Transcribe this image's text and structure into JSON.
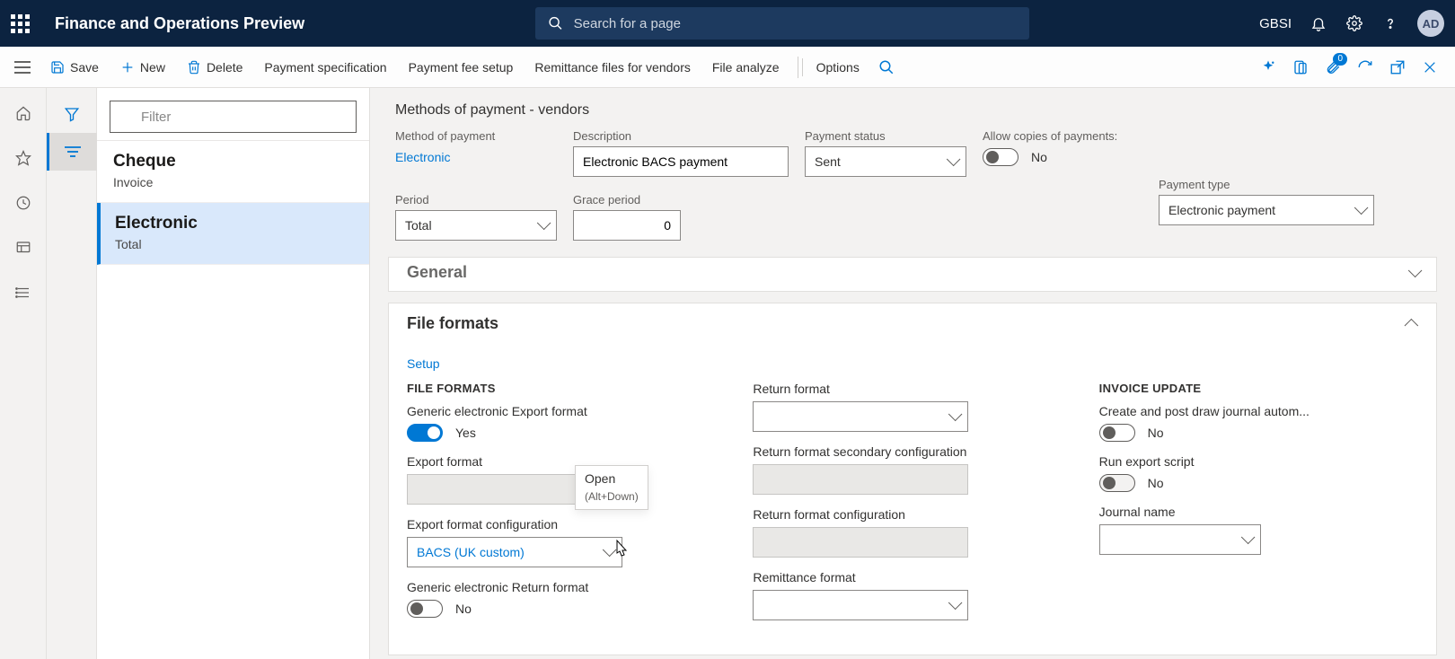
{
  "header": {
    "app_title": "Finance and Operations Preview",
    "search_placeholder": "Search for a page",
    "company": "GBSI",
    "avatar": "AD"
  },
  "actions": {
    "save": "Save",
    "new": "New",
    "delete": "Delete",
    "payment_spec": "Payment specification",
    "payment_fee": "Payment fee setup",
    "remittance": "Remittance files for vendors",
    "file_analyze": "File analyze",
    "options": "Options",
    "notif_badge": "0"
  },
  "filter": {
    "placeholder": "Filter"
  },
  "list": [
    {
      "title": "Cheque",
      "sub": "Invoice"
    },
    {
      "title": "Electronic",
      "sub": "Total"
    }
  ],
  "page": {
    "breadcrumb": "Methods of payment - vendors",
    "labels": {
      "method_of_payment": "Method of payment",
      "description": "Description",
      "payment_status": "Payment status",
      "allow_copies": "Allow copies of payments:",
      "period": "Period",
      "grace_period": "Grace period",
      "payment_type": "Payment type"
    },
    "values": {
      "method_of_payment": "Electronic",
      "description": "Electronic BACS payment",
      "payment_status": "Sent",
      "allow_copies": "No",
      "period": "Total",
      "grace_period": "0",
      "payment_type": "Electronic payment"
    },
    "sections": {
      "general": "General",
      "file_formats": "File formats"
    },
    "setup_link": "Setup",
    "file_formats_col_title": "FILE FORMATS",
    "invoice_update_col_title": "INVOICE UPDATE",
    "file_formats": {
      "generic_export_label": "Generic electronic Export format",
      "generic_export_value": "Yes",
      "export_format_label": "Export format",
      "export_format_value": "",
      "export_config_label": "Export format configuration",
      "export_config_value": "BACS (UK custom)",
      "generic_return_label": "Generic electronic Return format",
      "generic_return_value": "No",
      "return_format_label": "Return format",
      "return_format_value": "",
      "return_secondary_label": "Return format secondary configuration",
      "return_secondary_value": "",
      "return_config_label": "Return format configuration",
      "return_config_value": "",
      "remittance_format_label": "Remittance format",
      "remittance_format_value": ""
    },
    "invoice_update": {
      "create_post_label": "Create and post draw journal autom...",
      "create_post_value": "No",
      "run_export_label": "Run export script",
      "run_export_value": "No",
      "journal_name_label": "Journal name",
      "journal_name_value": ""
    },
    "tooltip": {
      "title": "Open",
      "shortcut": "(Alt+Down)"
    }
  }
}
